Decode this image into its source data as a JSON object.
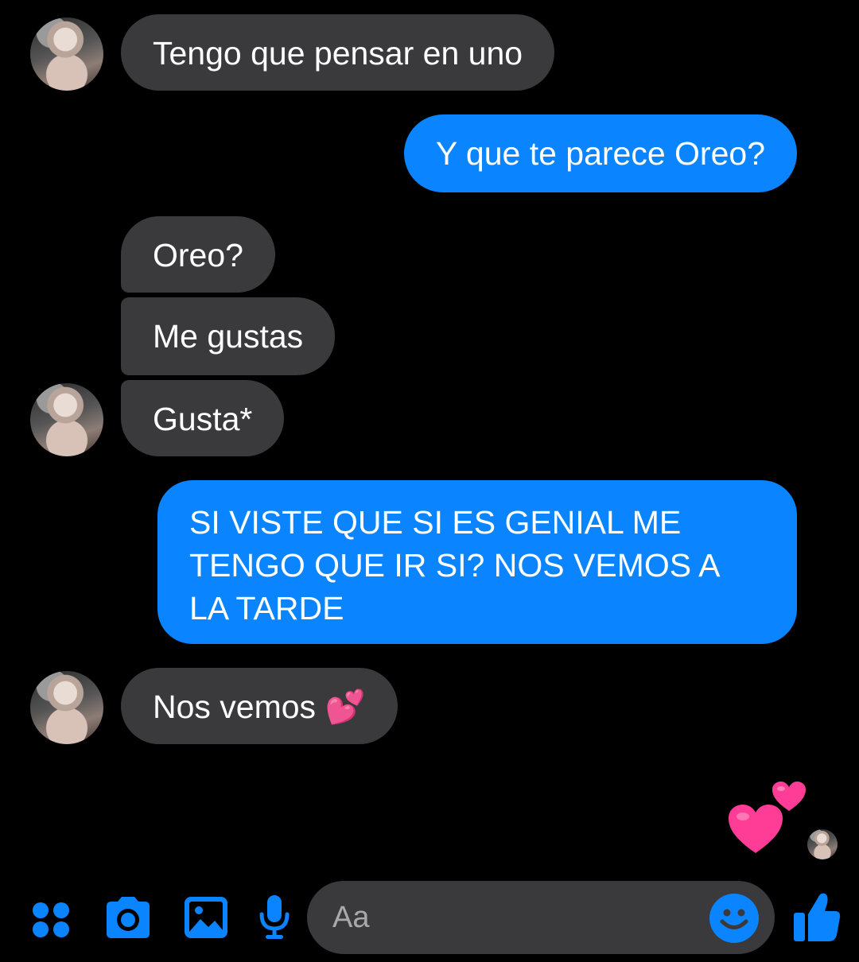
{
  "messages": [
    {
      "id": "m1",
      "side": "in",
      "text": "Tengo que pensar en uno"
    },
    {
      "id": "m2",
      "side": "out",
      "text": "Y que te parece Oreo?"
    },
    {
      "id": "m3",
      "side": "in",
      "text": "Oreo?"
    },
    {
      "id": "m4",
      "side": "in",
      "text": "Me gustas"
    },
    {
      "id": "m5",
      "side": "in",
      "text": "Gusta*"
    },
    {
      "id": "m6",
      "side": "out",
      "lines": [
        "SI VISTE QUE SI ES GENIAL ME",
        "TENGO QUE IR SI? NOS VEMOS A",
        "LA TARDE"
      ]
    },
    {
      "id": "m7",
      "side": "in",
      "text": "Nos vemos",
      "emoji": "💕"
    }
  ],
  "reaction": {
    "emoji": "💕"
  },
  "composer": {
    "placeholder": "Aa"
  },
  "icons": {
    "apps": "apps-grid-icon",
    "camera": "camera-icon",
    "gallery": "image-icon",
    "mic": "microphone-icon",
    "emoji": "smiley-icon",
    "like": "thumbs-up-icon"
  },
  "colors": {
    "background": "#000000",
    "incoming_bubble": "#3a3a3c",
    "outgoing_bubble": "#0a84ff",
    "accent": "#0a84ff",
    "heart": "#ff3d96"
  }
}
